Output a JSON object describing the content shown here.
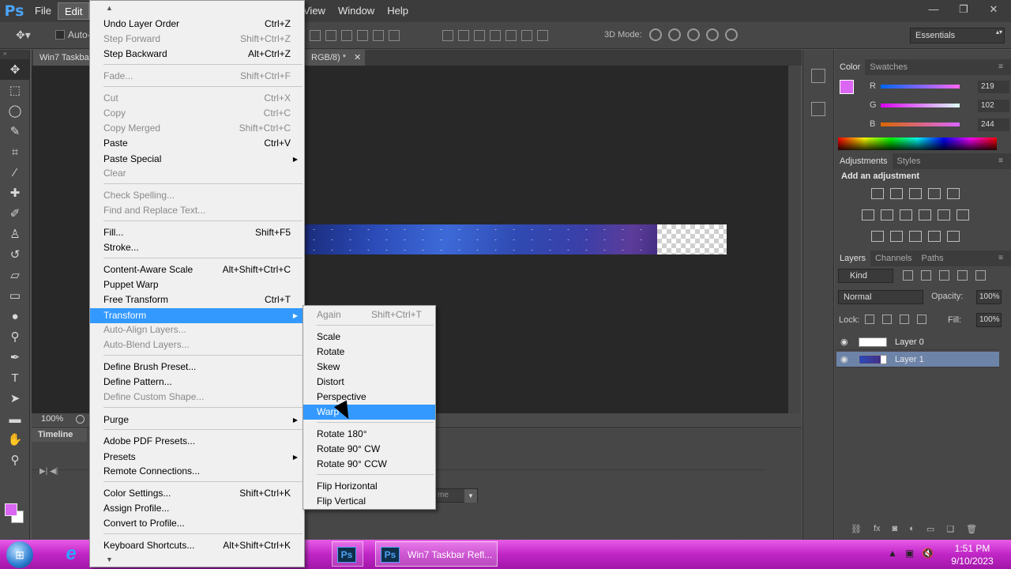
{
  "app": {
    "logo": "Ps",
    "menus_left": [
      "File",
      "Edit"
    ],
    "menus_right": [
      "View",
      "Window",
      "Help"
    ],
    "window_controls": [
      "—",
      "❐",
      "✕"
    ]
  },
  "options_bar": {
    "auto_select_label": "Auto-",
    "mode_3d_label": "3D Mode:",
    "workspace": "Essentials"
  },
  "document": {
    "tab_title": "Win7 Taskba",
    "tab_mode": "RGB/8) *",
    "tab_close": "✕",
    "zoom": "100%"
  },
  "timeline": {
    "tab_label": "Timeline",
    "dropdown_value": "me"
  },
  "edit_menu": {
    "items": [
      {
        "label": "Undo Layer Order",
        "shortcut": "Ctrl+Z",
        "enabled": true
      },
      {
        "label": "Step Forward",
        "shortcut": "Shift+Ctrl+Z",
        "enabled": false
      },
      {
        "label": "Step Backward",
        "shortcut": "Alt+Ctrl+Z",
        "enabled": true
      },
      {
        "label": "Fade...",
        "shortcut": "Shift+Ctrl+F",
        "enabled": false
      },
      {
        "label": "Cut",
        "shortcut": "Ctrl+X",
        "enabled": false
      },
      {
        "label": "Copy",
        "shortcut": "Ctrl+C",
        "enabled": false
      },
      {
        "label": "Copy Merged",
        "shortcut": "Shift+Ctrl+C",
        "enabled": false
      },
      {
        "label": "Paste",
        "shortcut": "Ctrl+V",
        "enabled": true
      },
      {
        "label": "Paste Special",
        "shortcut": "",
        "enabled": true
      },
      {
        "label": "Clear",
        "shortcut": "",
        "enabled": false
      },
      {
        "label": "Check Spelling...",
        "shortcut": "",
        "enabled": false
      },
      {
        "label": "Find and Replace Text...",
        "shortcut": "",
        "enabled": false
      },
      {
        "label": "Fill...",
        "shortcut": "Shift+F5",
        "enabled": true
      },
      {
        "label": "Stroke...",
        "shortcut": "",
        "enabled": true
      },
      {
        "label": "Content-Aware Scale",
        "shortcut": "Alt+Shift+Ctrl+C",
        "enabled": true
      },
      {
        "label": "Puppet Warp",
        "shortcut": "",
        "enabled": true
      },
      {
        "label": "Free Transform",
        "shortcut": "Ctrl+T",
        "enabled": true
      },
      {
        "label": "Transform",
        "shortcut": "",
        "enabled": true
      },
      {
        "label": "Auto-Align Layers...",
        "shortcut": "",
        "enabled": false
      },
      {
        "label": "Auto-Blend Layers...",
        "shortcut": "",
        "enabled": false
      },
      {
        "label": "Define Brush Preset...",
        "shortcut": "",
        "enabled": true
      },
      {
        "label": "Define Pattern...",
        "shortcut": "",
        "enabled": true
      },
      {
        "label": "Define Custom Shape...",
        "shortcut": "",
        "enabled": false
      },
      {
        "label": "Purge",
        "shortcut": "",
        "enabled": true
      },
      {
        "label": "Adobe PDF Presets...",
        "shortcut": "",
        "enabled": true
      },
      {
        "label": "Presets",
        "shortcut": "",
        "enabled": true
      },
      {
        "label": "Remote Connections...",
        "shortcut": "",
        "enabled": true
      },
      {
        "label": "Color Settings...",
        "shortcut": "Shift+Ctrl+K",
        "enabled": true
      },
      {
        "label": "Assign Profile...",
        "shortcut": "",
        "enabled": true
      },
      {
        "label": "Convert to Profile...",
        "shortcut": "",
        "enabled": true
      },
      {
        "label": "Keyboard Shortcuts...",
        "shortcut": "Alt+Shift+Ctrl+K",
        "enabled": true
      }
    ]
  },
  "transform_submenu": {
    "items": [
      {
        "label": "Again",
        "shortcut": "Shift+Ctrl+T",
        "enabled": false
      },
      {
        "label": "Scale",
        "shortcut": "",
        "enabled": true
      },
      {
        "label": "Rotate",
        "shortcut": "",
        "enabled": true
      },
      {
        "label": "Skew",
        "shortcut": "",
        "enabled": true
      },
      {
        "label": "Distort",
        "shortcut": "",
        "enabled": true
      },
      {
        "label": "Perspective",
        "shortcut": "",
        "enabled": true
      },
      {
        "label": "Warp",
        "shortcut": "",
        "enabled": true
      },
      {
        "label": "Rotate 180°",
        "shortcut": "",
        "enabled": true
      },
      {
        "label": "Rotate 90° CW",
        "shortcut": "",
        "enabled": true
      },
      {
        "label": "Rotate 90° CCW",
        "shortcut": "",
        "enabled": true
      },
      {
        "label": "Flip Horizontal",
        "shortcut": "",
        "enabled": true
      },
      {
        "label": "Flip Vertical",
        "shortcut": "",
        "enabled": true
      }
    ]
  },
  "color_panel": {
    "tabs": [
      "Color",
      "Swatches"
    ],
    "r_label": "R",
    "g_label": "G",
    "b_label": "B",
    "r": "219",
    "g": "102",
    "b": "244",
    "foreground": "#db66f4"
  },
  "adjustments_panel": {
    "tabs": [
      "Adjustments",
      "Styles"
    ],
    "title": "Add an adjustment"
  },
  "layers_panel": {
    "tabs": [
      "Layers",
      "Channels",
      "Paths"
    ],
    "kind": "Kind",
    "blend_mode": "Normal",
    "opacity_label": "Opacity:",
    "opacity": "100%",
    "lock_label": "Lock:",
    "fill_label": "Fill:",
    "fill": "100%",
    "layers": [
      {
        "name": "Layer 0",
        "selected": false
      },
      {
        "name": "Layer 1",
        "selected": true
      }
    ]
  },
  "taskbar": {
    "active_window": "Win7 Taskbar Refl...",
    "time": "1:51 PM",
    "date": "9/10/2023"
  }
}
